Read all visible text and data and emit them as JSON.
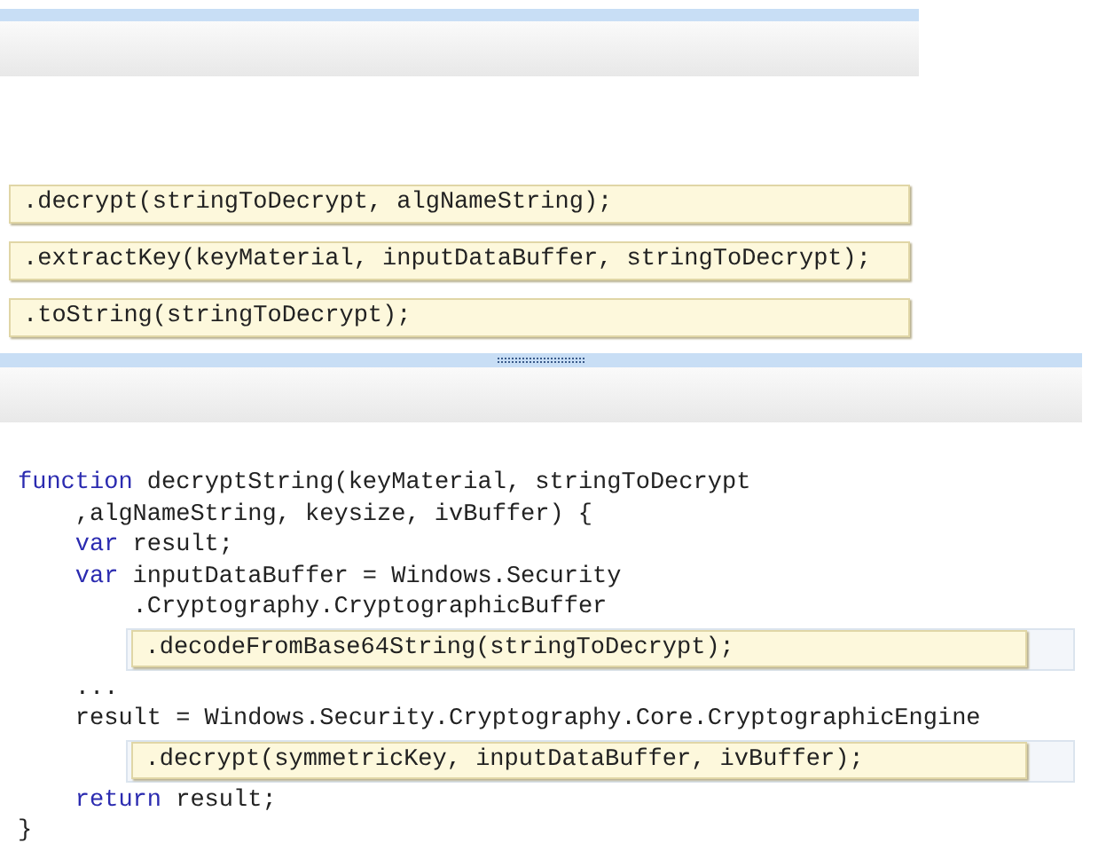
{
  "choices": [
    ".decrypt(stringToDecrypt, algNameString);",
    ".extractKey(keyMaterial, inputDataBuffer, stringToDecrypt);",
    ".toString(stringToDecrypt);"
  ],
  "code": [
    {
      "kind": "code",
      "parts": [
        {
          "kind": "keyword",
          "text": "function"
        },
        {
          "kind": "plain",
          "text": " decryptString(keyMaterial, stringToDecrypt"
        }
      ],
      "children": [
        {
          "kind": "code",
          "parts": [
            {
              "kind": "plain",
              "text": ",algNameString, keysize, ivBuffer) {"
            }
          ]
        },
        {
          "kind": "code",
          "parts": [
            {
              "kind": "keyword",
              "text": "var"
            },
            {
              "kind": "plain",
              "text": " result;"
            }
          ]
        },
        {
          "kind": "code",
          "parts": [
            {
              "kind": "keyword",
              "text": "var"
            },
            {
              "kind": "plain",
              "text": " inputDataBuffer = Windows.Security"
            }
          ],
          "children": [
            {
              "kind": "code",
              "parts": [
                {
                  "kind": "plain",
                  "text": ".Cryptography.CryptographicBuffer"
                }
              ]
            },
            {
              "kind": "slot",
              "answer": ".decodeFromBase64String(stringToDecrypt);"
            }
          ]
        },
        {
          "kind": "code",
          "parts": [
            {
              "kind": "plain",
              "text": "..."
            }
          ]
        },
        {
          "kind": "code",
          "parts": [
            {
              "kind": "plain",
              "text": "result = Windows.Security.Cryptography.Core.CryptographicEngine"
            }
          ],
          "children": [
            {
              "kind": "slot",
              "answer": ".decrypt(symmetricKey, inputDataBuffer, ivBuffer);"
            }
          ]
        },
        {
          "kind": "code",
          "parts": [
            {
              "kind": "keyword",
              "text": "return"
            },
            {
              "kind": "plain",
              "text": " result;"
            }
          ]
        }
      ]
    },
    {
      "kind": "code",
      "parts": [
        {
          "kind": "plain",
          "text": "}"
        }
      ]
    }
  ]
}
